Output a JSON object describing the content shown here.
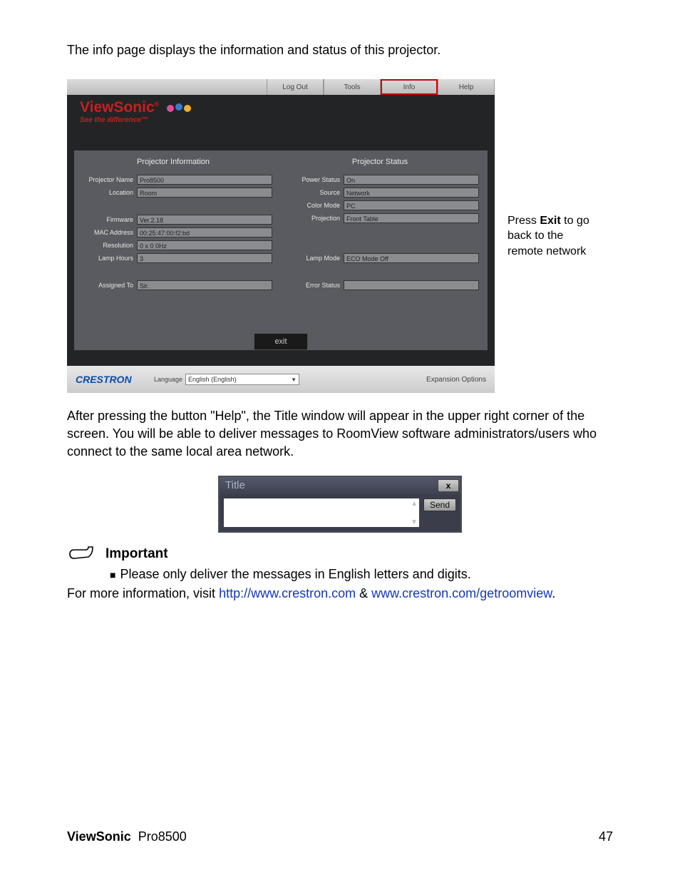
{
  "intro": "The info page displays the information and status of this projector.",
  "nav": {
    "logout": "Log Out",
    "tools": "Tools",
    "info": "Info",
    "help": "Help"
  },
  "logo": {
    "name": "ViewSonic",
    "tagline": "See the difference™"
  },
  "sections": {
    "projector_info": {
      "title": "Projector Information",
      "fields": {
        "projector_name": {
          "label": "Projector Name",
          "value": "Pro8500"
        },
        "location": {
          "label": "Location",
          "value": "Room"
        },
        "firmware": {
          "label": "Firmware",
          "value": "Ver.2.18"
        },
        "mac": {
          "label": "MAC Address",
          "value": "00:25:47:00:f2:bd"
        },
        "resolution": {
          "label": "Resolution",
          "value": "0 x 0 0Hz"
        },
        "lamp_hours": {
          "label": "Lamp Hours",
          "value": "3"
        },
        "assigned_to": {
          "label": "Assigned To",
          "value": "Sir."
        }
      }
    },
    "projector_status": {
      "title": "Projector Status",
      "fields": {
        "power": {
          "label": "Power Status",
          "value": "On"
        },
        "source": {
          "label": "Source",
          "value": "Network"
        },
        "color_mode": {
          "label": "Color Mode",
          "value": "PC"
        },
        "projection": {
          "label": "Projection",
          "value": "Front Table"
        },
        "lamp_mode": {
          "label": "Lamp Mode",
          "value": "ECO Mode Off"
        },
        "error": {
          "label": "Error Status",
          "value": ""
        }
      }
    }
  },
  "exit_button": "exit",
  "bottom": {
    "crestron": "CRESTRON",
    "language_label": "Language",
    "language_value": "English (English)",
    "expansion": "Expansion Options"
  },
  "side_note": {
    "pre": "Press ",
    "bold": "Exit",
    "post": " to go back to the remote network"
  },
  "para2": "After pressing the button \"Help\", the Title window will appear in the upper right corner of the screen. You will be able to deliver messages to RoomView software administrators/users who connect to the same local area network.",
  "help_window": {
    "title": "Title",
    "close": "x",
    "send": "Send"
  },
  "important": {
    "label": "Important",
    "bullet": "Please only deliver the messages in English letters and digits.",
    "more_pre": "For more information, visit ",
    "link1": "http://www.crestron.com",
    "amp": " & ",
    "link2": "www.crestron.com/getroomview",
    "period": "."
  },
  "footer": {
    "brand": "ViewSonic",
    "model": "Pro8500",
    "page": "47"
  }
}
